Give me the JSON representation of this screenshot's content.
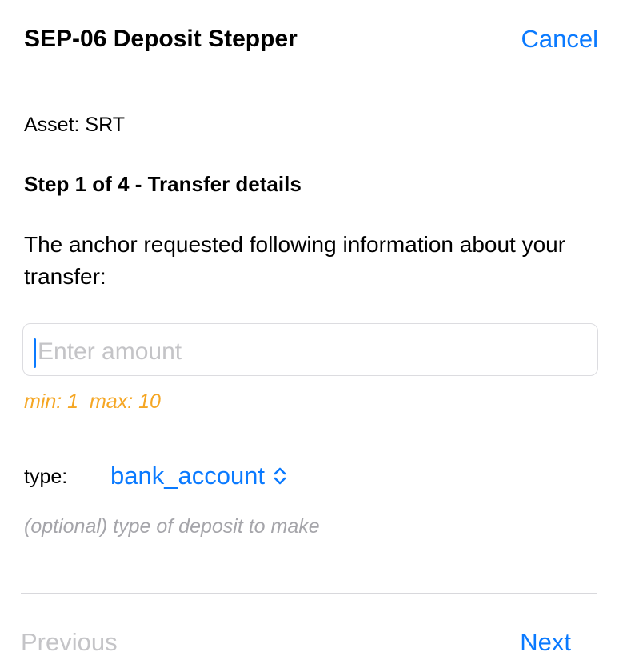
{
  "header": {
    "title": "SEP-06 Deposit Stepper",
    "cancel_label": "Cancel"
  },
  "asset": {
    "label": "Asset: SRT"
  },
  "step": {
    "title": "Step 1 of 4 - Transfer details"
  },
  "description": "The anchor requested following information about your transfer:",
  "amount_field": {
    "value": "",
    "placeholder": "Enter amount",
    "limits": "min: 1  max: 10"
  },
  "type_field": {
    "label": "type:",
    "selected": "bank_account",
    "hint": "(optional) type of deposit to make"
  },
  "footer": {
    "previous_label": "Previous",
    "next_label": "Next"
  },
  "colors": {
    "accent": "#0a7aff",
    "warning": "#f5a623",
    "disabled": "#c4c4c7",
    "hint": "#a5a5aa"
  },
  "icons": {
    "type_select": "chevron-up-down-icon"
  }
}
